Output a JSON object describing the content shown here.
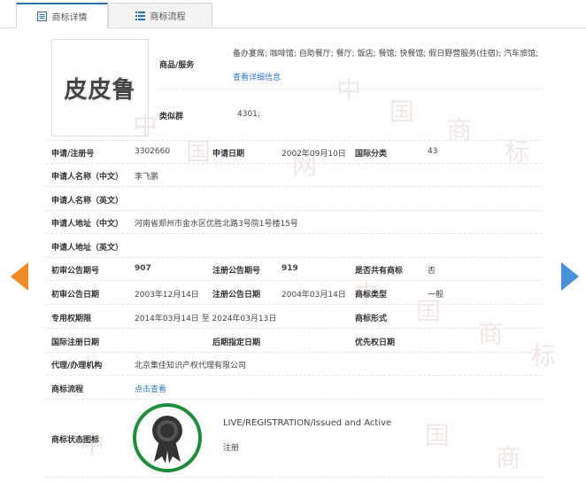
{
  "tabs": [
    {
      "label": "商标详情"
    },
    {
      "label": "商标流程"
    }
  ],
  "trademark": {
    "logo_text": "皮皮鲁",
    "goods_services_label": "商品/服务",
    "goods_services_value": "备办宴席; 咖啡馆; 自助餐厅; 餐厅; 饭店; 餐馆; 快餐馆; 假日野营服务(住宿); 汽车旅馆;",
    "view_details_link": "查看详细信息",
    "similar_group_label": "类似群",
    "similar_group_value": "4301;"
  },
  "rows": {
    "app_no_label": "申请/注册号",
    "app_no_value": "3302660",
    "app_date_label": "申请日期",
    "app_date_value": "2002年09月10日",
    "intl_class_label": "国际分类",
    "intl_class_value": "43",
    "applicant_cn_label": "申请人名称（中文）",
    "applicant_cn_value": "李飞鹏",
    "applicant_en_label": "申请人名称（英文）",
    "address_cn_label": "申请人地址（中文）",
    "address_cn_value": "河南省郑州市金水区优胜北路3号院1号楼15号",
    "address_en_label": "申请人地址（英文）",
    "prelim_pub_no_label": "初审公告期号",
    "prelim_pub_no_value": "907",
    "reg_pub_no_label": "注册公告期号",
    "reg_pub_no_value": "919",
    "shared_label": "是否共有商标",
    "shared_value": "否",
    "prelim_pub_date_label": "初审公告日期",
    "prelim_pub_date_value": "2003年12月14日",
    "reg_pub_date_label": "注册公告日期",
    "reg_pub_date_value": "2004年03月14日",
    "tm_type_label": "商标类型",
    "tm_type_value": "一般",
    "exclusive_period_label": "专用权期限",
    "exclusive_period_value": "2014年03月14日 至 2024年03月13日",
    "tm_form_label": "商标形式",
    "intl_reg_date_label": "国际注册日期",
    "later_designation_label": "后期指定日期",
    "priority_date_label": "优先权日期",
    "agent_label": "代理/办理机构",
    "agent_value": "北京集佳知识产权代理有限公司",
    "process_label": "商标流程",
    "process_link": "点击查看",
    "status_icon_label": "商标状态图标",
    "status_en": "LIVE/REGISTRATION/Issued and Active",
    "status_cn": "注册"
  },
  "colors": {
    "link": "#2e78c7",
    "prev_arrow": "#f08a24",
    "next_arrow": "#4a90d9",
    "status_ring": "#1e8c3a"
  },
  "icons": {
    "tab1": "document-icon",
    "tab2": "list-icon",
    "prev": "arrow-left-icon",
    "next": "arrow-right-icon",
    "status": "award-ribbon-icon"
  }
}
